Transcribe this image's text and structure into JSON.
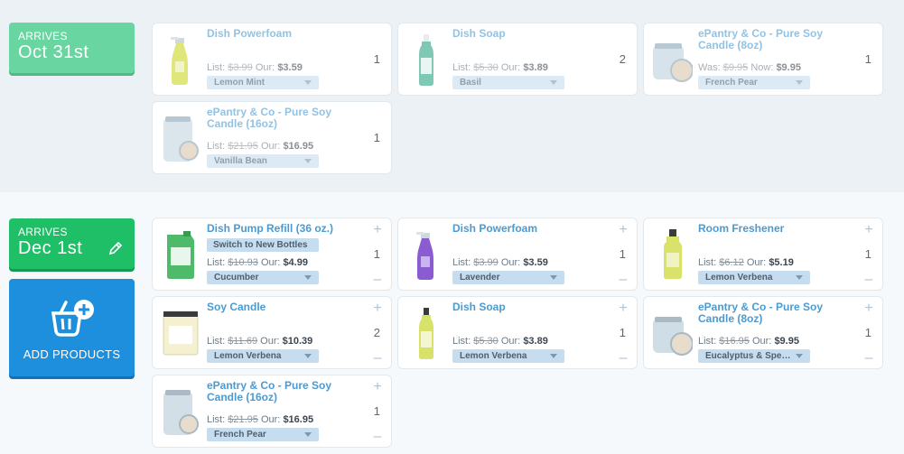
{
  "deliveries": [
    {
      "arrives_label": "ARRIVES",
      "date": "Oct 31st",
      "items": [
        {
          "name": "Dish Powerfoam",
          "label_a": "List:",
          "price_a": "$3.99",
          "label_b": "Our:",
          "price_b": "$3.59",
          "variant": "Lemon Mint",
          "qty": "1",
          "icon": "spray-bottle-yellow-icon"
        },
        {
          "name": "Dish Soap",
          "label_a": "List:",
          "price_a": "$5.30",
          "label_b": "Our:",
          "price_b": "$3.89",
          "variant": "Basil",
          "qty": "2",
          "icon": "dish-soap-green-icon"
        },
        {
          "name": "ePantry & Co - Pure Soy Candle (8oz)",
          "label_a": "Was:",
          "price_a": "$9.95",
          "label_b": "Now:",
          "price_b": "$9.95",
          "variant": "French Pear",
          "qty": "1",
          "icon": "candle-jar-small-icon"
        },
        {
          "name": "ePantry & Co - Pure Soy Candle (16oz)",
          "label_a": "List:",
          "price_a": "$21.95",
          "label_b": "Our:",
          "price_b": "$16.95",
          "variant": "Vanilla Bean",
          "qty": "1",
          "icon": "candle-jar-large-icon"
        }
      ]
    },
    {
      "arrives_label": "ARRIVES",
      "date": "Dec 1st",
      "items": [
        {
          "name": "Dish Pump Refill (36 oz.)",
          "switch": "Switch to New Bottles",
          "label_a": "List:",
          "price_a": "$10.93",
          "label_b": "Our:",
          "price_b": "$4.99",
          "variant": "Cucumber",
          "qty": "1",
          "icon": "refill-pouch-icon"
        },
        {
          "name": "Dish Powerfoam",
          "label_a": "List:",
          "price_a": "$3.99",
          "label_b": "Our:",
          "price_b": "$3.59",
          "variant": "Lavender",
          "qty": "1",
          "icon": "spray-bottle-purple-icon"
        },
        {
          "name": "Room Freshener",
          "label_a": "List:",
          "price_a": "$6.12",
          "label_b": "Our:",
          "price_b": "$5.19",
          "variant": "Lemon Verbena",
          "qty": "1",
          "icon": "room-spray-icon"
        },
        {
          "name": "Soy Candle",
          "label_a": "List:",
          "price_a": "$11.69",
          "label_b": "Our:",
          "price_b": "$10.39",
          "variant": "Lemon Verbena",
          "qty": "2",
          "icon": "soy-candle-icon"
        },
        {
          "name": "Dish Soap",
          "label_a": "List:",
          "price_a": "$5.30",
          "label_b": "Our:",
          "price_b": "$3.89",
          "variant": "Lemon Verbena",
          "qty": "1",
          "icon": "dish-soap-yellow-icon"
        },
        {
          "name": "ePantry & Co - Pure Soy Candle (8oz)",
          "label_a": "List:",
          "price_a": "$16.95",
          "label_b": "Our:",
          "price_b": "$9.95",
          "variant": "Eucalyptus & Spe…",
          "qty": "1",
          "icon": "candle-jar-small-icon"
        },
        {
          "name": "ePantry & Co - Pure Soy Candle (16oz)",
          "label_a": "List:",
          "price_a": "$21.95",
          "label_b": "Our:",
          "price_b": "$16.95",
          "variant": "French Pear",
          "qty": "1",
          "icon": "candle-jar-large-icon"
        }
      ]
    }
  ],
  "add_products": {
    "label": "ADD PRODUCTS",
    "icon": "basket-add-icon"
  },
  "controls": {
    "plus": "+",
    "minus": "–",
    "edit_icon": "pencil-icon"
  },
  "colors": {
    "accent_blue": "#1e8fdc",
    "green": "#1fbf68",
    "light_green": "#69d5a0",
    "name_blue": "#4a9bd1"
  }
}
